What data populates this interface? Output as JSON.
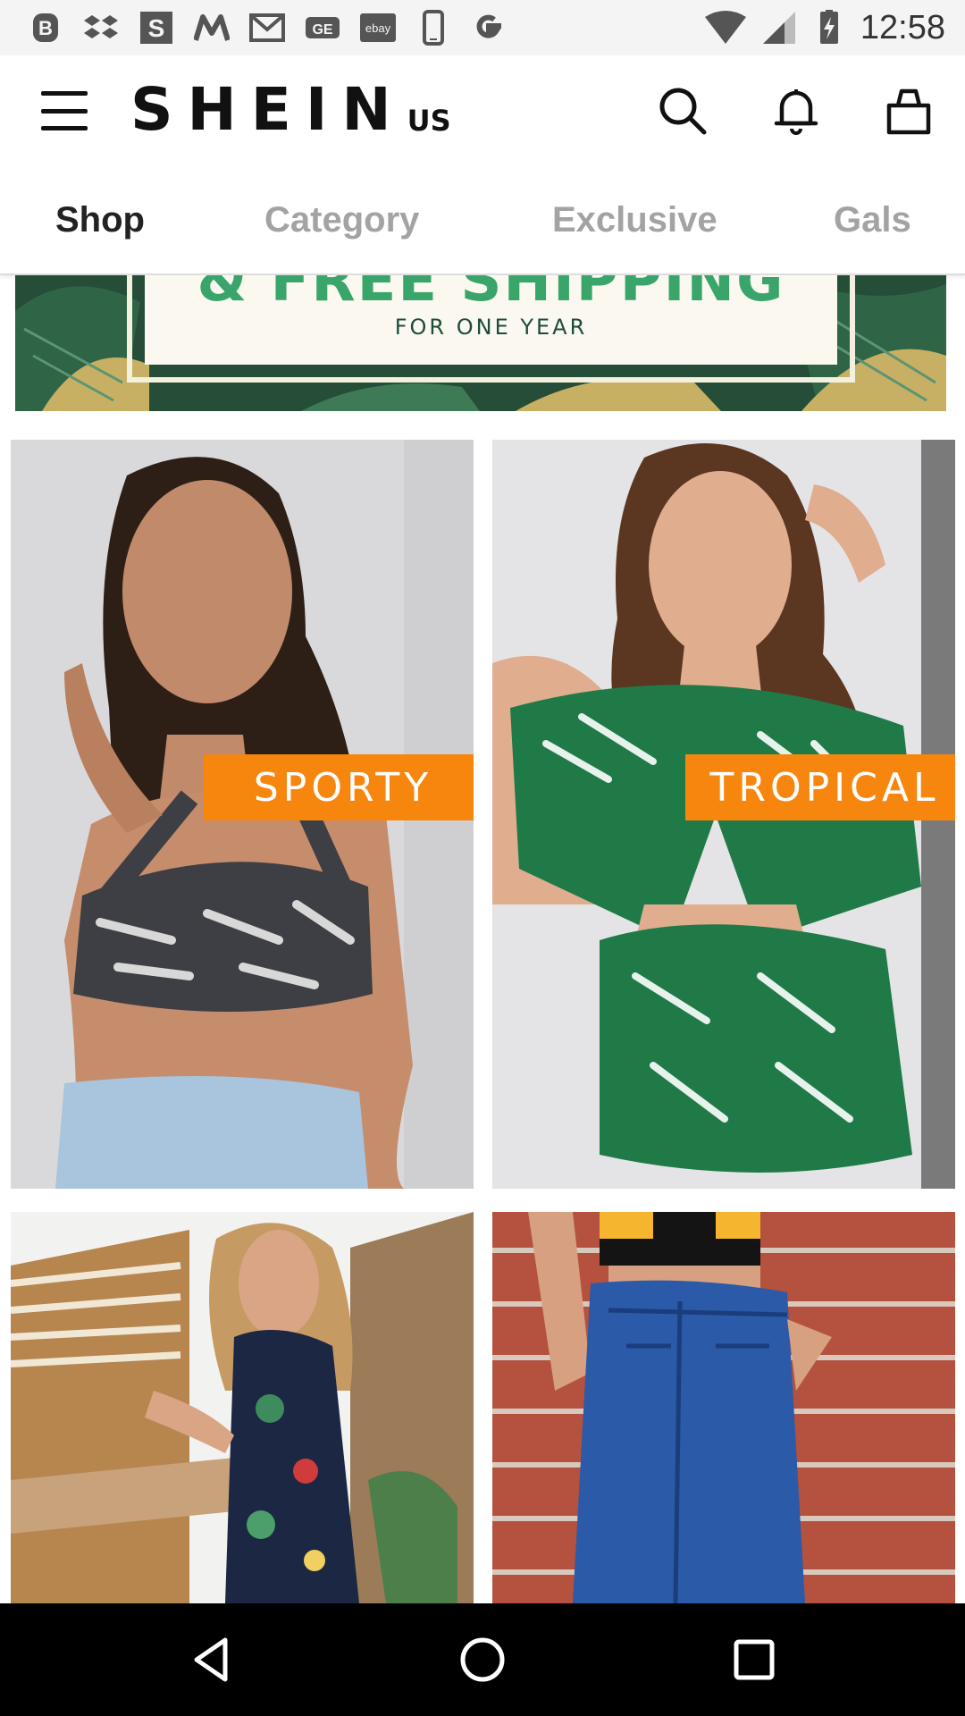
{
  "status_bar": {
    "time": "12:58",
    "notification_icons": [
      "b-icon",
      "dropbox-icon",
      "s-icon",
      "m-icon",
      "gmail-icon",
      "ge-icon",
      "ebay-icon",
      "phone-icon",
      "google-icon"
    ],
    "ebay_label": "ebay",
    "ge_label": "GE",
    "s_label": "S"
  },
  "header": {
    "logo": "SHEIN",
    "region": "US"
  },
  "tabs": [
    {
      "label": "Shop",
      "active": true
    },
    {
      "label": "Category",
      "active": false
    },
    {
      "label": "Exclusive",
      "active": false
    },
    {
      "label": "Gals",
      "active": false
    }
  ],
  "banner": {
    "title": "& FREE SHIPPING",
    "subtitle": "FOR ONE YEAR"
  },
  "tiles": [
    {
      "tag": "SPORTY"
    },
    {
      "tag": "TROPICAL"
    },
    {
      "tag": ""
    },
    {
      "tag": ""
    }
  ],
  "colors": {
    "accent_tag": "#f7860f",
    "active_tab": "#222222",
    "inactive_tab": "#a3a3a3"
  }
}
